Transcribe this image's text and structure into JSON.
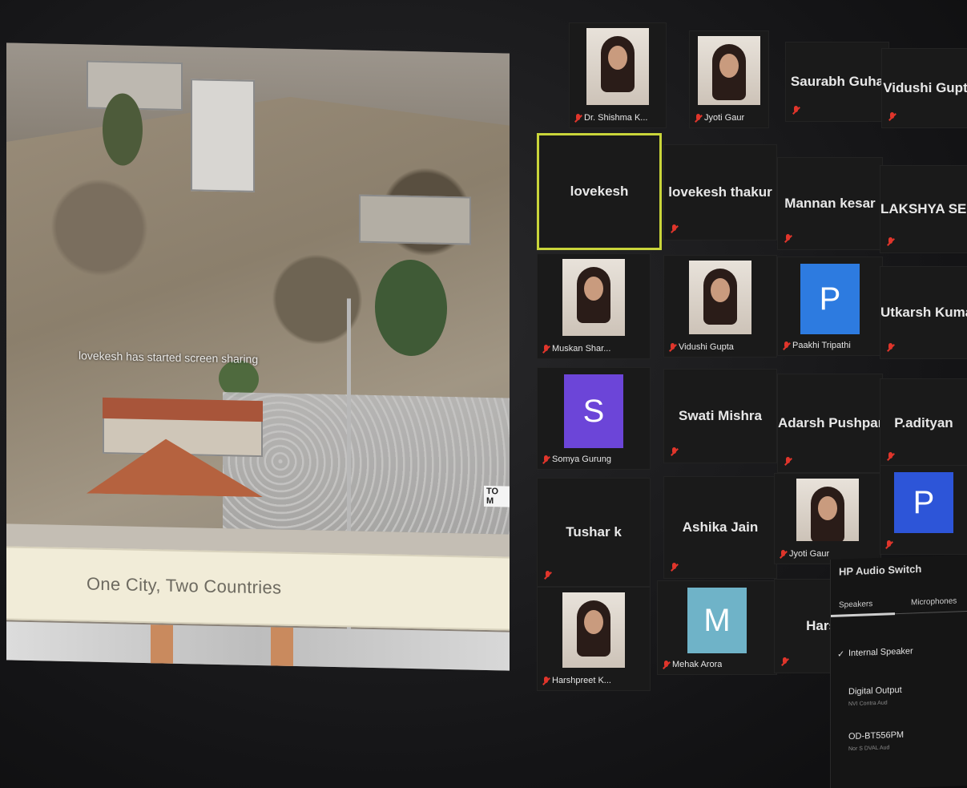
{
  "share": {
    "notice": "lovekesh has started screen sharing",
    "caption": "One City, Two Countries",
    "sign": "TO M"
  },
  "participants": [
    {
      "name": "Dr. Shishma K...",
      "kind": "photo"
    },
    {
      "name": "Jyoti Gaur",
      "kind": "photo"
    },
    {
      "name": "Saurabh Guha",
      "kind": "text"
    },
    {
      "name": "Vidushi Gupt",
      "kind": "text"
    },
    {
      "name": "lovekesh",
      "kind": "text",
      "active": true
    },
    {
      "name": "lovekesh thakur",
      "kind": "text"
    },
    {
      "name": "Mannan kesar",
      "kind": "text"
    },
    {
      "name": "LAKSHYA SEHG",
      "kind": "text"
    },
    {
      "name": "Muskan Shar...",
      "kind": "photo"
    },
    {
      "name": "Vidushi Gupta",
      "kind": "photo"
    },
    {
      "name": "Paakhi Tripathi",
      "kind": "avatar",
      "letter": "P",
      "color": "#2d7be0"
    },
    {
      "name": "Utkarsh Kumar.",
      "kind": "text"
    },
    {
      "name": "Somya Gurung",
      "kind": "avatar",
      "letter": "S",
      "color": "#6c45d8"
    },
    {
      "name": "Swati Mishra",
      "kind": "text"
    },
    {
      "name": "Adarsh Pushpam",
      "kind": "text"
    },
    {
      "name": "P.adityan",
      "kind": "text"
    },
    {
      "name": "Tushar k",
      "kind": "text"
    },
    {
      "name": "Ashika Jain",
      "kind": "text"
    },
    {
      "name": "Jyoti Gaur",
      "kind": "photo"
    },
    {
      "name": "",
      "kind": "avatar",
      "letter": "P",
      "color": "#2d55d8"
    },
    {
      "name": "Harshpreet K...",
      "kind": "photo"
    },
    {
      "name": "Mehak Arora",
      "kind": "avatar",
      "letter": "M",
      "color": "#6fb3c8"
    },
    {
      "name": "Hars",
      "kind": "text"
    }
  ],
  "audio_switch": {
    "title": "HP Audio Switch",
    "tabs": [
      "Speakers",
      "Microphones"
    ],
    "items": [
      {
        "label": "Internal Speaker",
        "sub": "",
        "selected": true
      },
      {
        "label": "Digital Output",
        "sub": "NVI Contra Aud",
        "selected": false
      },
      {
        "label": "OD-BT556PM",
        "sub": "Nor S DVAL Aud",
        "selected": false
      }
    ]
  },
  "colors": {
    "active_border": "#c9d53a",
    "mute_red": "#e0352b",
    "tile_bg": "#1a1a1a"
  }
}
